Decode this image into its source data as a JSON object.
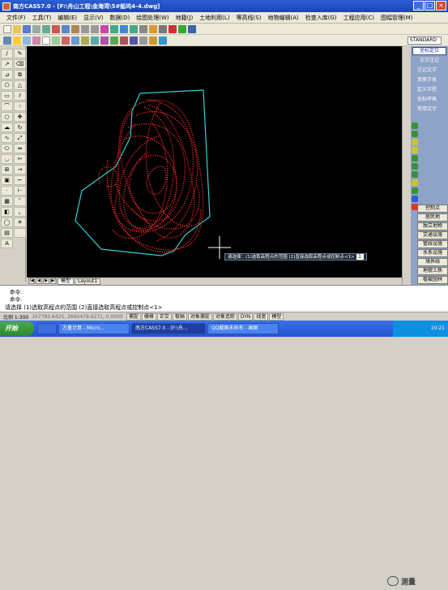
{
  "window": {
    "title": "南方CASS7.0 - [F:\\舟山工程\\金海湾\\5#船坞4-4.dwg]"
  },
  "menu": [
    "文件(F)",
    "工具(T)",
    "编辑(E)",
    "显示(V)",
    "数据(D)",
    "绘图处理(W)",
    "地籍(J)",
    "土地利用(L)",
    "等高线(S)",
    "地物编辑(A)",
    "检查入库(G)",
    "工程应用(C)",
    "图幅管理(M)"
  ],
  "toolbar3": {
    "layer_combo": "STANDARD"
  },
  "right_panel": {
    "top_button": "坐标定位",
    "items": [
      "文字注记",
      "注记文字",
      "变换字体",
      "定义字型",
      "坐标坪高",
      "常用文字"
    ],
    "bottom_buttons": [
      "控制点",
      "居民地",
      "独立地物",
      "交通设施",
      "管线设施",
      "水系设施",
      "境界线",
      "地貌土质",
      "植被园林"
    ]
  },
  "canvas": {
    "tooltip": "请选择：(1)选取高程点的范围  (2)直接选取高程点或控制点<1>",
    "tooltip_value": "1"
  },
  "tabs": {
    "model": "模型",
    "layout": "Layout1"
  },
  "command": {
    "line1": "命令:",
    "line2": "命令:",
    "line3": "请选择 (1)选取高程点的范围 (2)直接选取高程点或控制点<1>"
  },
  "status": {
    "scale": "比例 1:300",
    "coords": "167783.6425, 2660479.9271, 0.0000",
    "buttons": [
      "捕捉",
      "栅格",
      "正交",
      "极轴",
      "对象捕捉",
      "对象追踪",
      "DYN",
      "线宽",
      "模型"
    ]
  },
  "taskbar": {
    "start": "开始",
    "tasks": [
      "方量计算 - Micro...",
      "南方CASS7.0 - [F:\\舟...",
      "QQ截图未命名 - 画图"
    ],
    "time": "10:21"
  },
  "watermark": {
    "text": "测量"
  }
}
